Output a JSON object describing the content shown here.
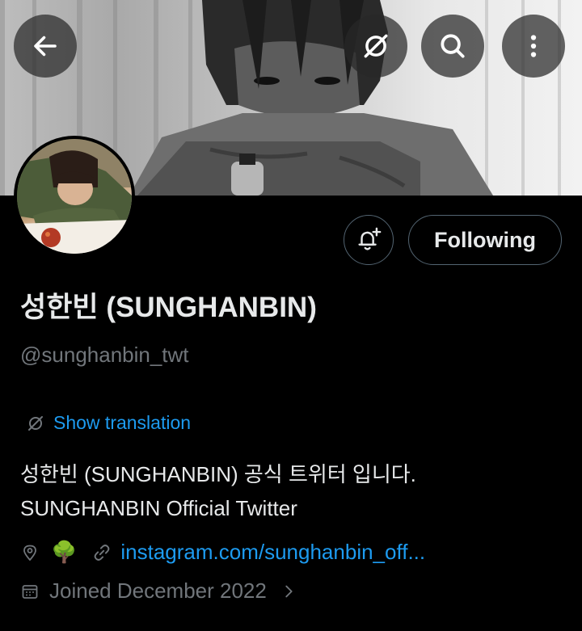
{
  "header": {
    "back_icon": "arrow-left-icon",
    "translate_icon": "translate-slash-icon",
    "search_icon": "search-icon",
    "more_icon": "more-vertical-icon"
  },
  "actions": {
    "notify_icon": "bell-plus-icon",
    "following_label": "Following"
  },
  "profile": {
    "name": "성한빈 (SUNGHANBIN)",
    "handle": "@sunghanbin_twt",
    "translate_label": "Show translation",
    "bio_line1": "성한빈 (SUNGHANBIN) 공식 트위터 입니다.",
    "bio_line2": "SUNGHANBIN Official Twitter",
    "location_emoji": "🌳",
    "website": "instagram.com/sunghanbin_off...",
    "joined": "Joined December 2022"
  },
  "colors": {
    "background": "#000000",
    "text_primary": "#e7e9ea",
    "text_secondary": "#71767b",
    "link": "#1d9bf0",
    "border": "#536471"
  }
}
